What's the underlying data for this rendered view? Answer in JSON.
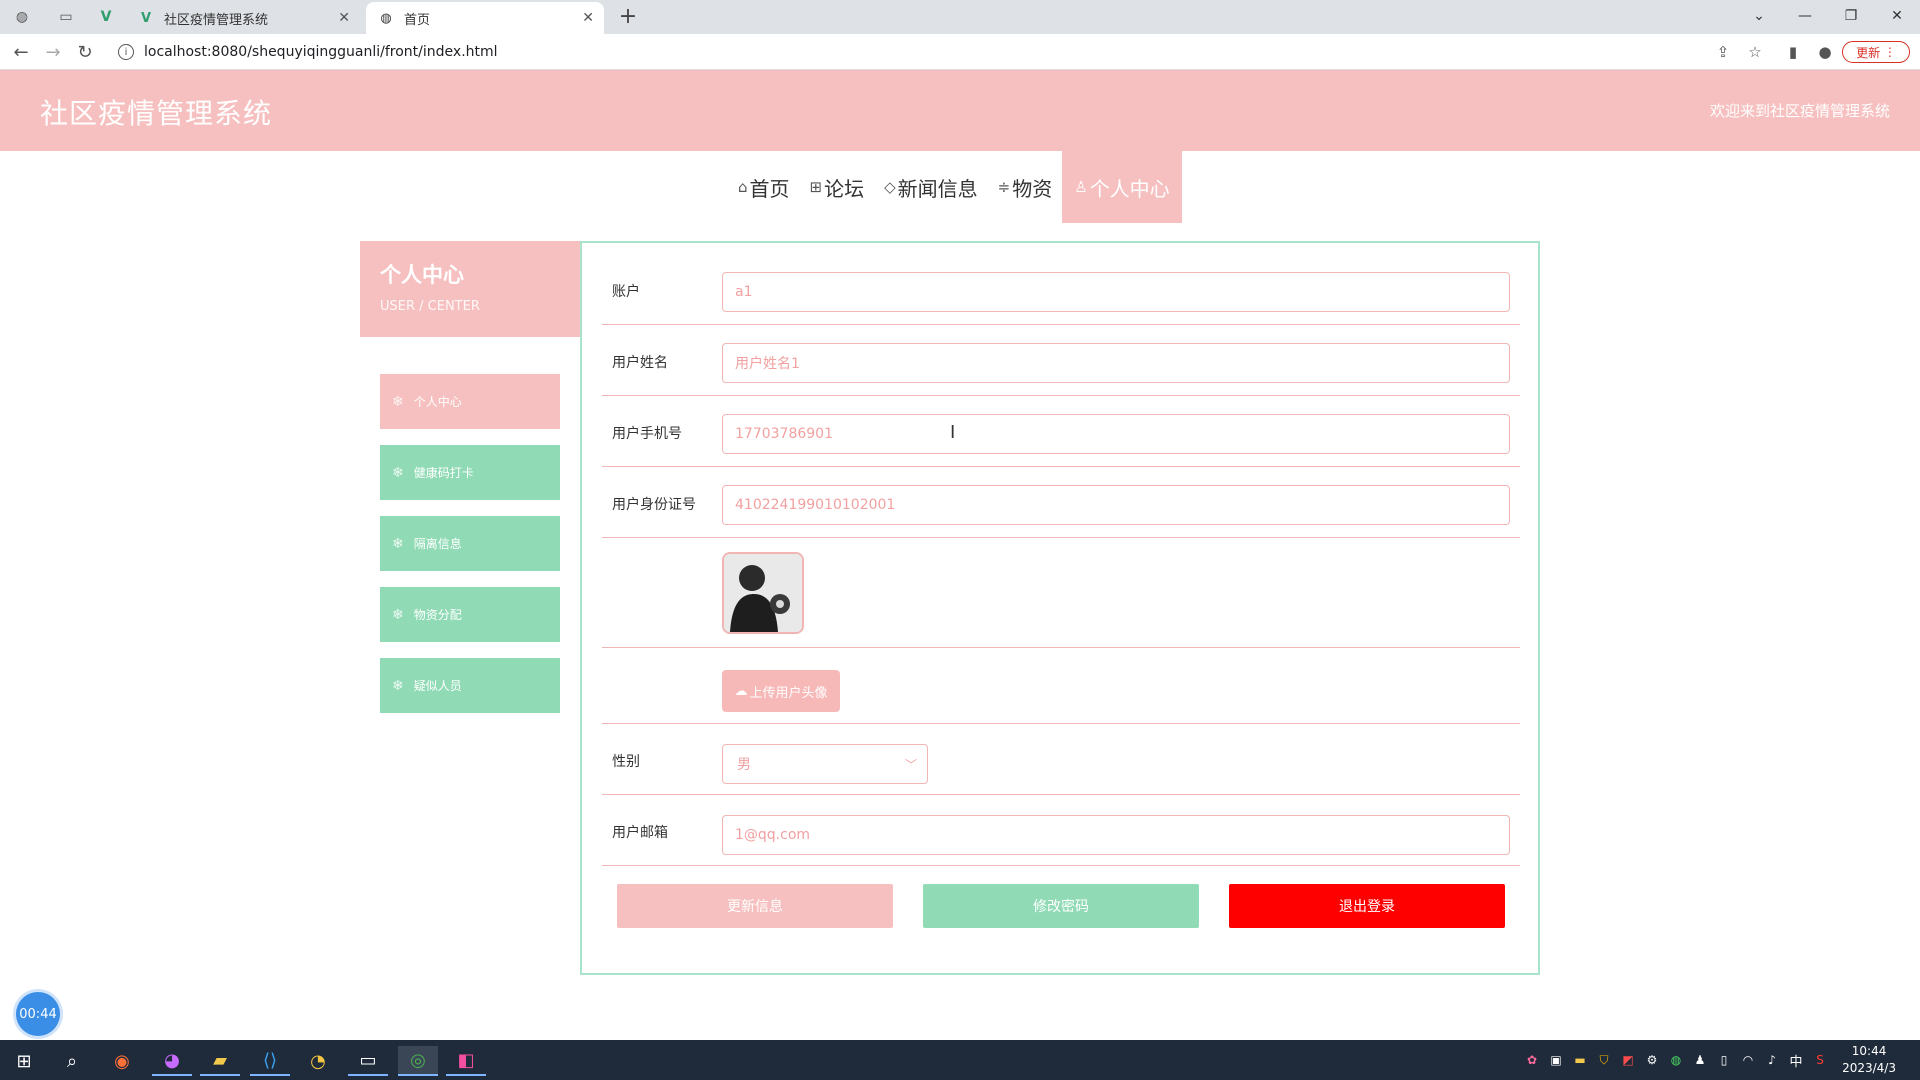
{
  "browser": {
    "tabs": [
      {
        "title": "社区疫情管理系统",
        "active": false
      },
      {
        "title": "首页",
        "active": true
      }
    ],
    "url": "localhost:8080/shequyiqingguanli/front/index.html",
    "update_label": "更新"
  },
  "header": {
    "title": "社区疫情管理系统",
    "welcome": "欢迎来到社区疫情管理系统"
  },
  "nav": {
    "items": [
      {
        "label": "首页",
        "icon": "home-icon"
      },
      {
        "label": "论坛",
        "icon": "forum-icon"
      },
      {
        "label": "新闻信息",
        "icon": "tag-icon"
      },
      {
        "label": "物资",
        "icon": "sliders-icon"
      },
      {
        "label": "个人中心",
        "icon": "user-icon",
        "active": true
      }
    ]
  },
  "sidebar": {
    "title": "个人中心",
    "subtitle": "USER / CENTER",
    "items": [
      {
        "label": "个人中心",
        "active": true
      },
      {
        "label": "健康码打卡"
      },
      {
        "label": "隔离信息"
      },
      {
        "label": "物资分配"
      },
      {
        "label": "疑似人员"
      }
    ]
  },
  "form": {
    "account": {
      "label": "账户",
      "value": "a1"
    },
    "name": {
      "label": "用户姓名",
      "value": "用户姓名1"
    },
    "phone": {
      "label": "用户手机号",
      "value": "17703786901"
    },
    "idcard": {
      "label": "用户身份证号",
      "value": "410224199010102001"
    },
    "upload_label": "上传用户头像",
    "gender": {
      "label": "性别",
      "value": "男"
    },
    "email": {
      "label": "用户邮箱",
      "value": "1@qq.com"
    }
  },
  "actions": {
    "update": "更新信息",
    "change_password": "修改密码",
    "logout": "退出登录"
  },
  "colors": {
    "header_pink": "#f7c0c0",
    "menu_green": "#90dbb5",
    "logout_red": "#ff0000",
    "border_pink": "#f2b5b5"
  },
  "timer": "00:44",
  "clock": {
    "time": "10:44",
    "date": "2023/4/3"
  },
  "tray": {
    "ime": "中"
  }
}
